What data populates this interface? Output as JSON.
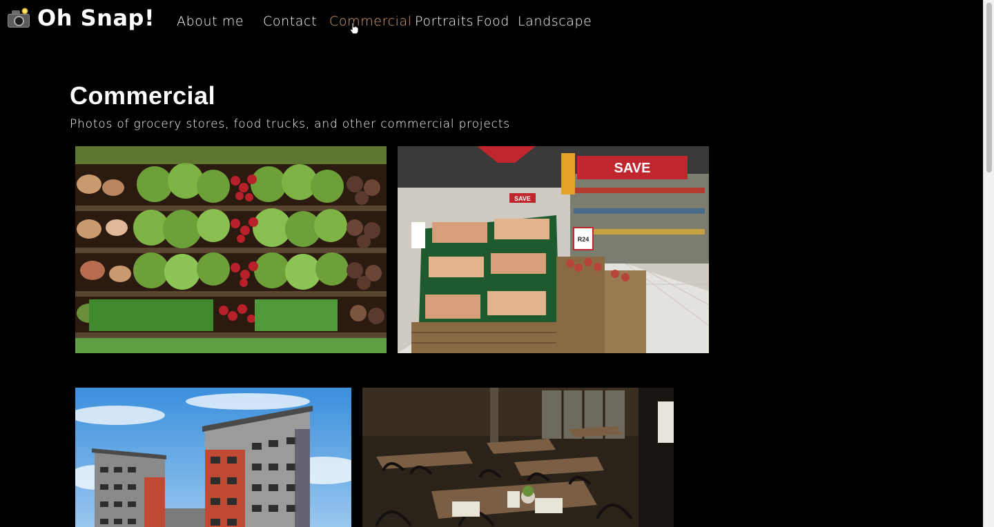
{
  "header": {
    "site_title": "Oh Snap!",
    "logo_icon": "camera-flash-icon"
  },
  "nav": {
    "items": [
      {
        "label": "About me",
        "active": false
      },
      {
        "label": "Contact",
        "active": false
      },
      {
        "label": "Commercial",
        "active": true
      },
      {
        "label": "Portraits",
        "active": false
      },
      {
        "label": "Food",
        "active": false
      },
      {
        "label": "Landscape",
        "active": false
      }
    ],
    "active_color": "#d9a479"
  },
  "main": {
    "title": "Commercial",
    "subtitle": "Photos of grocery stores, food trucks, and other commercial projects"
  },
  "gallery": {
    "photos": [
      {
        "subject": "produce-shelves-photo"
      },
      {
        "subject": "supermarket-aisle-photo"
      },
      {
        "subject": "apartment-building-photo"
      },
      {
        "subject": "restaurant-interior-photo"
      }
    ],
    "sign_text": {
      "save_banner": "SAVE",
      "save_tag": "SAVE",
      "price_tag": "R24"
    }
  },
  "colors": {
    "background": "#000000",
    "text": "#ffffff",
    "accent": "#d9a479"
  }
}
